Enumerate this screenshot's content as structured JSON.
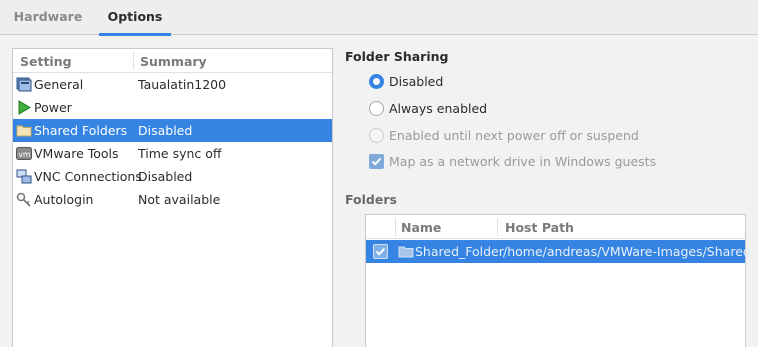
{
  "tabs": [
    {
      "label": "Hardware"
    },
    {
      "label": "Options"
    }
  ],
  "settings_table": {
    "columns": [
      "Setting",
      "Summary"
    ],
    "rows": [
      {
        "name": "General",
        "summary": "Taualatin1200",
        "icon": "general-icon"
      },
      {
        "name": "Power",
        "summary": "",
        "icon": "play-icon"
      },
      {
        "name": "Shared Folders",
        "summary": "Disabled",
        "icon": "folder-icon"
      },
      {
        "name": "VMware Tools",
        "summary": "Time sync off",
        "icon": "vm-icon"
      },
      {
        "name": "VNC Connections",
        "summary": "Disabled",
        "icon": "vnc-icon"
      },
      {
        "name": "Autologin",
        "summary": "Not available",
        "icon": "key-icon"
      }
    ]
  },
  "folder_sharing": {
    "title": "Folder Sharing",
    "options": [
      {
        "label": "Disabled",
        "checked": true
      },
      {
        "label": "Always enabled",
        "checked": false
      },
      {
        "label": "Enabled until next power off or suspend",
        "checked": false
      }
    ],
    "map_drive_label": "Map as a network drive in Windows guests"
  },
  "folders": {
    "title": "Folders",
    "columns": [
      "Name",
      "Host Path"
    ],
    "rows": [
      {
        "name": "Shared_Folder",
        "path": "/home/andreas/VMWare-Images/Shared",
        "checked": true
      }
    ]
  },
  "colors": {
    "accent": "#3584e4"
  }
}
